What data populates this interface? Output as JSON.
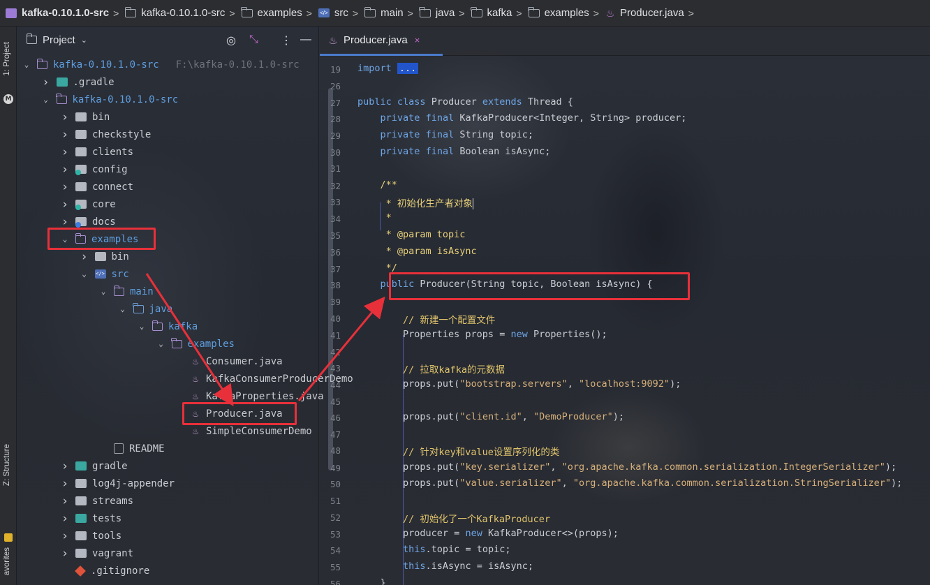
{
  "breadcrumbs": [
    {
      "label": "kafka-0.10.1.0-src",
      "icon": "project-icon"
    },
    {
      "label": "kafka-0.10.1.0-src",
      "icon": "folder-icon"
    },
    {
      "label": "examples",
      "icon": "folder-icon"
    },
    {
      "label": "src",
      "icon": "source-folder-icon"
    },
    {
      "label": "main",
      "icon": "folder-icon"
    },
    {
      "label": "java",
      "icon": "folder-icon"
    },
    {
      "label": "kafka",
      "icon": "folder-icon"
    },
    {
      "label": "examples",
      "icon": "folder-icon"
    },
    {
      "label": "Producer.java",
      "icon": "java-class-icon"
    }
  ],
  "tool_stripe": {
    "project_label": "1: Project",
    "structure_label": "Z: Structure",
    "favorites_label": "avorites",
    "m_badge": "M"
  },
  "project_panel": {
    "title": "Project",
    "tree": [
      {
        "label": "kafka-0.10.1.0-src",
        "hint": "F:\\kafka-0.10.1.0-src",
        "arrow": "expanded",
        "icon": "folder",
        "blue": true
      },
      {
        "label": ".gradle",
        "arrow": "collapsed",
        "icon": "teal"
      },
      {
        "label": "kafka-0.10.1.0-src",
        "arrow": "expanded",
        "icon": "folder",
        "blue": true
      },
      {
        "label": "bin",
        "arrow": "collapsed",
        "icon": "gray"
      },
      {
        "label": "checkstyle",
        "arrow": "collapsed",
        "icon": "gray"
      },
      {
        "label": "clients",
        "arrow": "collapsed",
        "icon": "gray"
      },
      {
        "label": "config",
        "arrow": "collapsed",
        "icon": "gray-badge-teal"
      },
      {
        "label": "connect",
        "arrow": "collapsed",
        "icon": "gray"
      },
      {
        "label": "core",
        "arrow": "collapsed",
        "icon": "gray-badge-teal"
      },
      {
        "label": "docs",
        "arrow": "collapsed",
        "icon": "gray-badge-blue"
      },
      {
        "label": "examples",
        "arrow": "expanded",
        "icon": "folder",
        "blue": true
      },
      {
        "label": "bin",
        "arrow": "collapsed",
        "icon": "gray"
      },
      {
        "label": "src",
        "arrow": "expanded",
        "icon": "src",
        "blue": true
      },
      {
        "label": "main",
        "arrow": "expanded",
        "icon": "folder",
        "blue": true
      },
      {
        "label": "java",
        "arrow": "expanded",
        "icon": "folder-blue",
        "blue": true
      },
      {
        "label": "kafka",
        "arrow": "expanded",
        "icon": "folder",
        "blue": true
      },
      {
        "label": "examples",
        "arrow": "expanded",
        "icon": "folder",
        "blue": true
      },
      {
        "label": "Consumer.java",
        "arrow": "none",
        "icon": "java"
      },
      {
        "label": "KafkaConsumerProducerDemo",
        "arrow": "none",
        "icon": "java"
      },
      {
        "label": "KafkaProperties.java",
        "arrow": "none",
        "icon": "java"
      },
      {
        "label": "Producer.java",
        "arrow": "none",
        "icon": "java"
      },
      {
        "label": "SimpleConsumerDemo",
        "arrow": "none",
        "icon": "java"
      },
      {
        "label": "README",
        "arrow": "none",
        "icon": "readme"
      },
      {
        "label": "gradle",
        "arrow": "collapsed",
        "icon": "teal"
      },
      {
        "label": "log4j-appender",
        "arrow": "collapsed",
        "icon": "gray"
      },
      {
        "label": "streams",
        "arrow": "collapsed",
        "icon": "gray"
      },
      {
        "label": "tests",
        "arrow": "collapsed",
        "icon": "teal"
      },
      {
        "label": "tools",
        "arrow": "collapsed",
        "icon": "gray"
      },
      {
        "label": "vagrant",
        "arrow": "collapsed",
        "icon": "gray"
      },
      {
        "label": ".gitignore",
        "arrow": "none",
        "icon": "git"
      }
    ]
  },
  "editor": {
    "tab_label": "Producer.java",
    "tab_close": "×",
    "lines": [
      {
        "n": "19",
        "code": "import ..."
      },
      {
        "n": "26",
        "code": ""
      },
      {
        "n": "27",
        "code": "public class Producer extends Thread {"
      },
      {
        "n": "28",
        "code": "    private final KafkaProducer<Integer, String> producer;"
      },
      {
        "n": "29",
        "code": "    private final String topic;"
      },
      {
        "n": "30",
        "code": "    private final Boolean isAsync;"
      },
      {
        "n": "31",
        "code": ""
      },
      {
        "n": "32",
        "code": "    /**"
      },
      {
        "n": "33",
        "code": "     * 初始化生产者对象"
      },
      {
        "n": "34",
        "code": "     *"
      },
      {
        "n": "35",
        "code": "     * @param topic"
      },
      {
        "n": "36",
        "code": "     * @param isAsync"
      },
      {
        "n": "37",
        "code": "     */"
      },
      {
        "n": "38",
        "code": "    public Producer(String topic, Boolean isAsync) {"
      },
      {
        "n": "39",
        "code": ""
      },
      {
        "n": "40",
        "code": "        // 新建一个配置文件"
      },
      {
        "n": "41",
        "code": "        Properties props = new Properties();"
      },
      {
        "n": "42",
        "code": ""
      },
      {
        "n": "43",
        "code": "        // 拉取kafka的元数据"
      },
      {
        "n": "44",
        "code": "        props.put(\"bootstrap.servers\", \"localhost:9092\");"
      },
      {
        "n": "45",
        "code": ""
      },
      {
        "n": "46",
        "code": "        props.put(\"client.id\", \"DemoProducer\");"
      },
      {
        "n": "47",
        "code": ""
      },
      {
        "n": "48",
        "code": "        // 针对key和value设置序列化的类"
      },
      {
        "n": "49",
        "code": "        props.put(\"key.serializer\", \"org.apache.kafka.common.serialization.IntegerSerializer\");"
      },
      {
        "n": "50",
        "code": "        props.put(\"value.serializer\", \"org.apache.kafka.common.serialization.StringSerializer\");"
      },
      {
        "n": "51",
        "code": ""
      },
      {
        "n": "52",
        "code": "        // 初始化了一个KafkaProducer"
      },
      {
        "n": "53",
        "code": "        producer = new KafkaProducer<>(props);"
      },
      {
        "n": "54",
        "code": "        this.topic = topic;"
      },
      {
        "n": "55",
        "code": "        this.isAsync = isAsync;"
      },
      {
        "n": "56",
        "code": "    }"
      }
    ]
  },
  "colors": {
    "keyword": "#6ea6e6",
    "comment": "#e0c46c",
    "string": "#d6b07a",
    "annotation_red": "#e8303a",
    "tab_underline": "#4a7acc"
  }
}
